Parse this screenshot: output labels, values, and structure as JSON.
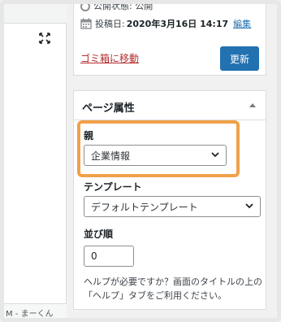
{
  "editor": {
    "caption": "M - まーくん"
  },
  "publish": {
    "status_text": "公開状態: 公開",
    "date_label": "投稿日:",
    "date_value": "2020年3月16日 14:17",
    "edit_link": "編集",
    "trash_link": "ゴミ箱に移動",
    "update_button": "更新"
  },
  "page_attributes": {
    "title": "ページ属性",
    "parent_label": "親",
    "parent_value": "企業情報",
    "template_label": "テンプレート",
    "template_value": "デフォルトテンプレート",
    "order_label": "並び順",
    "order_value": "0",
    "help_text": "ヘルプが必要ですか？画面のタイトルの上の「ヘルプ」タブをご利用ください。"
  },
  "colors": {
    "accent": "#2271b1",
    "trash": "#b32d2e",
    "highlight": "#f0a14a"
  }
}
